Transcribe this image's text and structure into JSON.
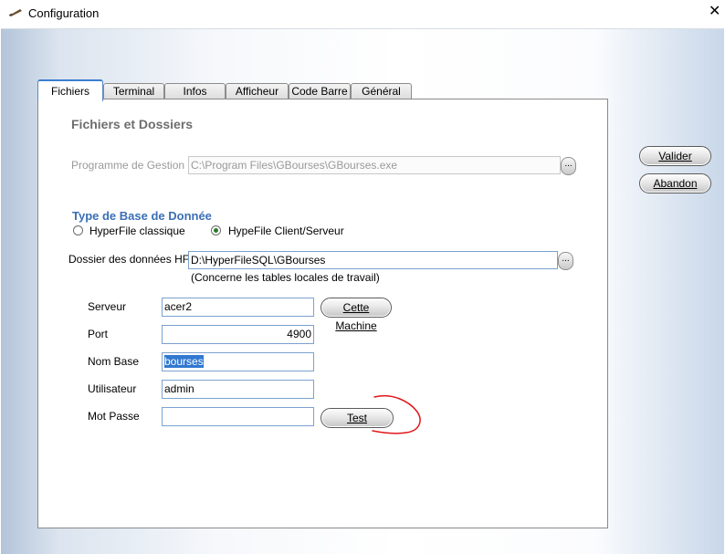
{
  "window": {
    "title": "Configuration",
    "close_glyph": "✕"
  },
  "tabs": [
    {
      "label": "Fichiers",
      "active": true
    },
    {
      "label": "Terminal",
      "active": false
    },
    {
      "label": "Infos",
      "active": false
    },
    {
      "label": "Afficheur",
      "active": false
    },
    {
      "label": "Code Barre",
      "active": false
    },
    {
      "label": "Général",
      "active": false
    }
  ],
  "fichiers": {
    "section_title": "Fichiers et Dossiers",
    "programme": {
      "label": "Programme de Gestion :",
      "value": "C:\\Program Files\\GBourses\\GBourses.exe",
      "browse": "..."
    },
    "db_type": {
      "title": "Type de Base de Donnée",
      "option_classic": "HyperFile classique",
      "option_cs": "HypeFile Client/Serveur",
      "selected": "client-serveur"
    },
    "dossier": {
      "label": "Dossier des données HF :",
      "value": "D:\\HyperFileSQL\\GBourses",
      "browse": "...",
      "hint": "(Concerne les tables locales de travail)"
    },
    "serveur": {
      "label": "Serveur",
      "value": "acer2"
    },
    "port": {
      "label": "Port",
      "value": "4900"
    },
    "nom_base": {
      "label": "Nom Base",
      "value": "bourses"
    },
    "utilisateur": {
      "label": "Utilisateur",
      "value": "admin"
    },
    "mot_passe": {
      "label": "Mot Passe",
      "value": ""
    },
    "cette_machine_label": "Cette Machine",
    "test_label": "Test"
  },
  "actions": {
    "valider_label": "Valider",
    "abandon_label": "Abandon"
  },
  "colors": {
    "accent": "#3c7fd1",
    "annotation": "#e0161b"
  },
  "icons": {
    "app": "quill-pen-icon",
    "close": "close-icon",
    "radio": "radio-button-icon"
  }
}
